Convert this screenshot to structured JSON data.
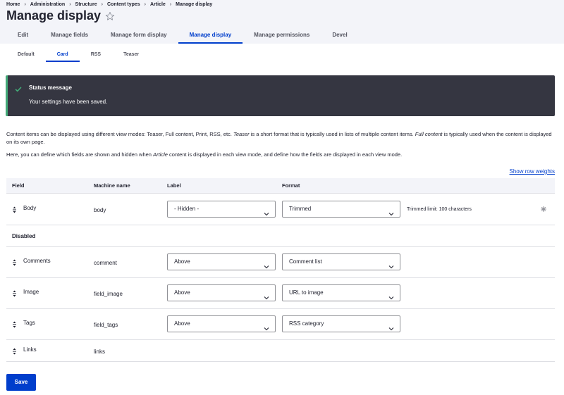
{
  "breadcrumb": [
    "Home",
    "Administration",
    "Structure",
    "Content types",
    "Article",
    "Manage display"
  ],
  "breadcrumb_separator": "›",
  "page_title": "Manage display",
  "primary_tabs": [
    {
      "label": "Edit",
      "active": false
    },
    {
      "label": "Manage fields",
      "active": false
    },
    {
      "label": "Manage form display",
      "active": false
    },
    {
      "label": "Manage display",
      "active": true
    },
    {
      "label": "Manage permissions",
      "active": false
    },
    {
      "label": "Devel",
      "active": false
    }
  ],
  "secondary_tabs": [
    {
      "label": "Default",
      "active": false
    },
    {
      "label": "Card",
      "active": true
    },
    {
      "label": "RSS",
      "active": false
    },
    {
      "label": "Teaser",
      "active": false
    }
  ],
  "status": {
    "title": "Status message",
    "message": "Your settings have been saved."
  },
  "intro": {
    "p1_a": "Content items can be displayed using different view modes: Teaser, Full content, Print, RSS, etc. ",
    "p1_em1": "Teaser",
    "p1_b": " is a short format that is typically used in lists of multiple content items. ",
    "p1_em2": "Full content",
    "p1_c": " is typically used when the content is displayed on its own page.",
    "p2_a": "Here, you can define which fields are shown and hidden when ",
    "p2_em": "Article",
    "p2_b": " content is displayed in each view mode, and define how the fields are displayed in each view mode."
  },
  "show_row_weights": "Show row weights",
  "table": {
    "headers": {
      "field": "Field",
      "machine": "Machine name",
      "label": "Label",
      "format": "Format"
    },
    "region_disabled": "Disabled",
    "body": {
      "field": "Body",
      "machine": "body",
      "label": "- Hidden -",
      "format": "Trimmed",
      "summary": "Trimmed limit: 100 characters"
    },
    "comments": {
      "field": "Comments",
      "machine": "comment",
      "label": "Above",
      "format": "Comment list"
    },
    "image": {
      "field": "Image",
      "machine": "field_image",
      "label": "Above",
      "format": "URL to image"
    },
    "tags": {
      "field": "Tags",
      "machine": "field_tags",
      "label": "Above",
      "format": "RSS category"
    },
    "links": {
      "field": "Links",
      "machine": "links"
    }
  },
  "save_label": "Save",
  "colors": {
    "accent": "#003ecc",
    "status_bg": "#353641",
    "status_success": "#42a877"
  }
}
